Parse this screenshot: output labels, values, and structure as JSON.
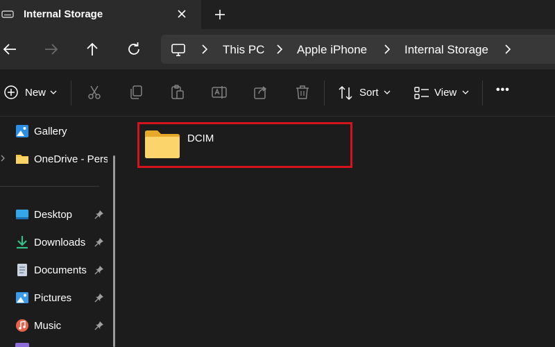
{
  "window": {
    "tab_title": "Internal Storage",
    "tab_icon": "drive-icon"
  },
  "address": {
    "crumbs": [
      "This PC",
      "Apple iPhone",
      "Internal Storage"
    ]
  },
  "commandbar": {
    "new_label": "New",
    "sort_label": "Sort",
    "view_label": "View",
    "more_label": "•••"
  },
  "sidebar": {
    "items": [
      {
        "label": "Gallery",
        "icon": "gallery-icon"
      },
      {
        "label": "OneDrive - Personal",
        "icon": "folder-icon"
      },
      {
        "label": "Desktop",
        "icon": "desktop-icon",
        "pinned": true
      },
      {
        "label": "Downloads",
        "icon": "download-icon",
        "pinned": true
      },
      {
        "label": "Documents",
        "icon": "documents-icon",
        "pinned": true
      },
      {
        "label": "Pictures",
        "icon": "pictures-icon",
        "pinned": true
      },
      {
        "label": "Music",
        "icon": "music-icon",
        "pinned": true
      }
    ]
  },
  "content": {
    "items": [
      {
        "name": "DCIM",
        "type": "folder",
        "highlighted": true
      }
    ]
  },
  "colors": {
    "background": "#1c1c1c",
    "address_row": "#2b2b2b",
    "highlight": "#d4141c",
    "folder": "#f6c445"
  }
}
